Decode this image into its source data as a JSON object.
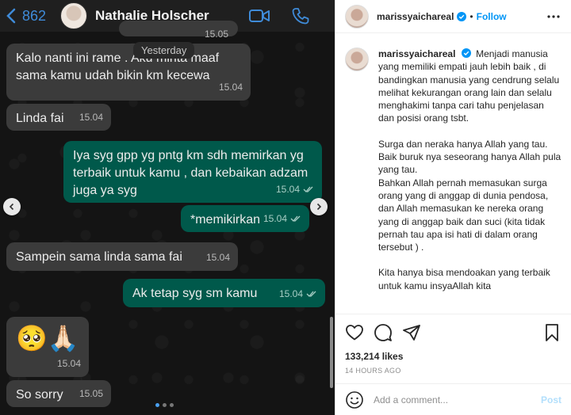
{
  "chat": {
    "unread_count": "862",
    "contact_name": "Nathalie Holscher",
    "clipped_time": "15.05",
    "date_divider": "Yesterday",
    "messages": [
      {
        "dir": "in",
        "text": "Kalo nanti ini rame . Aku minta maaf sama kamu udah bikin km kecewa",
        "time": "15.04"
      },
      {
        "dir": "in",
        "text": "Linda fai",
        "time": "15.04"
      },
      {
        "dir": "out",
        "text": "Iya syg gpp yg pntg km sdh memirkan yg terbaik untuk kamu , dan kebaikan adzam juga ya syg",
        "time": "15.04"
      },
      {
        "dir": "out",
        "text": "*memikirkan",
        "time": "15.04"
      },
      {
        "dir": "in",
        "text": "Sampein sama linda sama fai",
        "time": "15.04"
      },
      {
        "dir": "out",
        "text": "Ak tetap syg sm kamu",
        "time": "15.04"
      },
      {
        "dir": "in",
        "text": "🥺🙏🏻",
        "time": "15.04"
      },
      {
        "dir": "in",
        "text": "So sorry",
        "time": "15.05"
      }
    ]
  },
  "post": {
    "username": "marissyaichareal",
    "follow_label": "Follow",
    "caption": [
      "Menjadi manusia yang memiliki empati jauh lebih baik , di bandingkan manusia yang cendrung selalu melihat kekurangan orang lain dan selalu menghakimi tanpa cari tahu penjelasan dan posisi orang tsbt.",
      "Surga dan neraka hanya Allah yang tau.\nBaik buruk nya seseorang hanya Allah pula yang tau.\nBahkan Allah pernah memasukan surga orang yang di anggap di dunia pendosa, dan Allah memasukan ke nereka orang yang di anggap baik dan suci (kita tidak pernah tau apa isi hati di dalam orang tersebut ) .",
      "Kita hanya bisa mendoakan yang terbaik untuk kamu insyaAllah kita"
    ],
    "likes": "133,214 likes",
    "time_ago": "14 HOURS AGO",
    "comment_placeholder": "Add a comment...",
    "post_label": "Post"
  },
  "colors": {
    "chat_bg": "#141414",
    "incoming_bubble": "#3b3b3b",
    "outgoing_bubble": "#00594b",
    "ig_blue": "#0095f6"
  },
  "icons": [
    "chevron-left-icon",
    "video-call-icon",
    "phone-icon",
    "double-check-icon",
    "verified-badge-icon",
    "more-icon",
    "heart-icon",
    "comment-icon",
    "share-icon",
    "bookmark-icon",
    "emoji-icon"
  ]
}
